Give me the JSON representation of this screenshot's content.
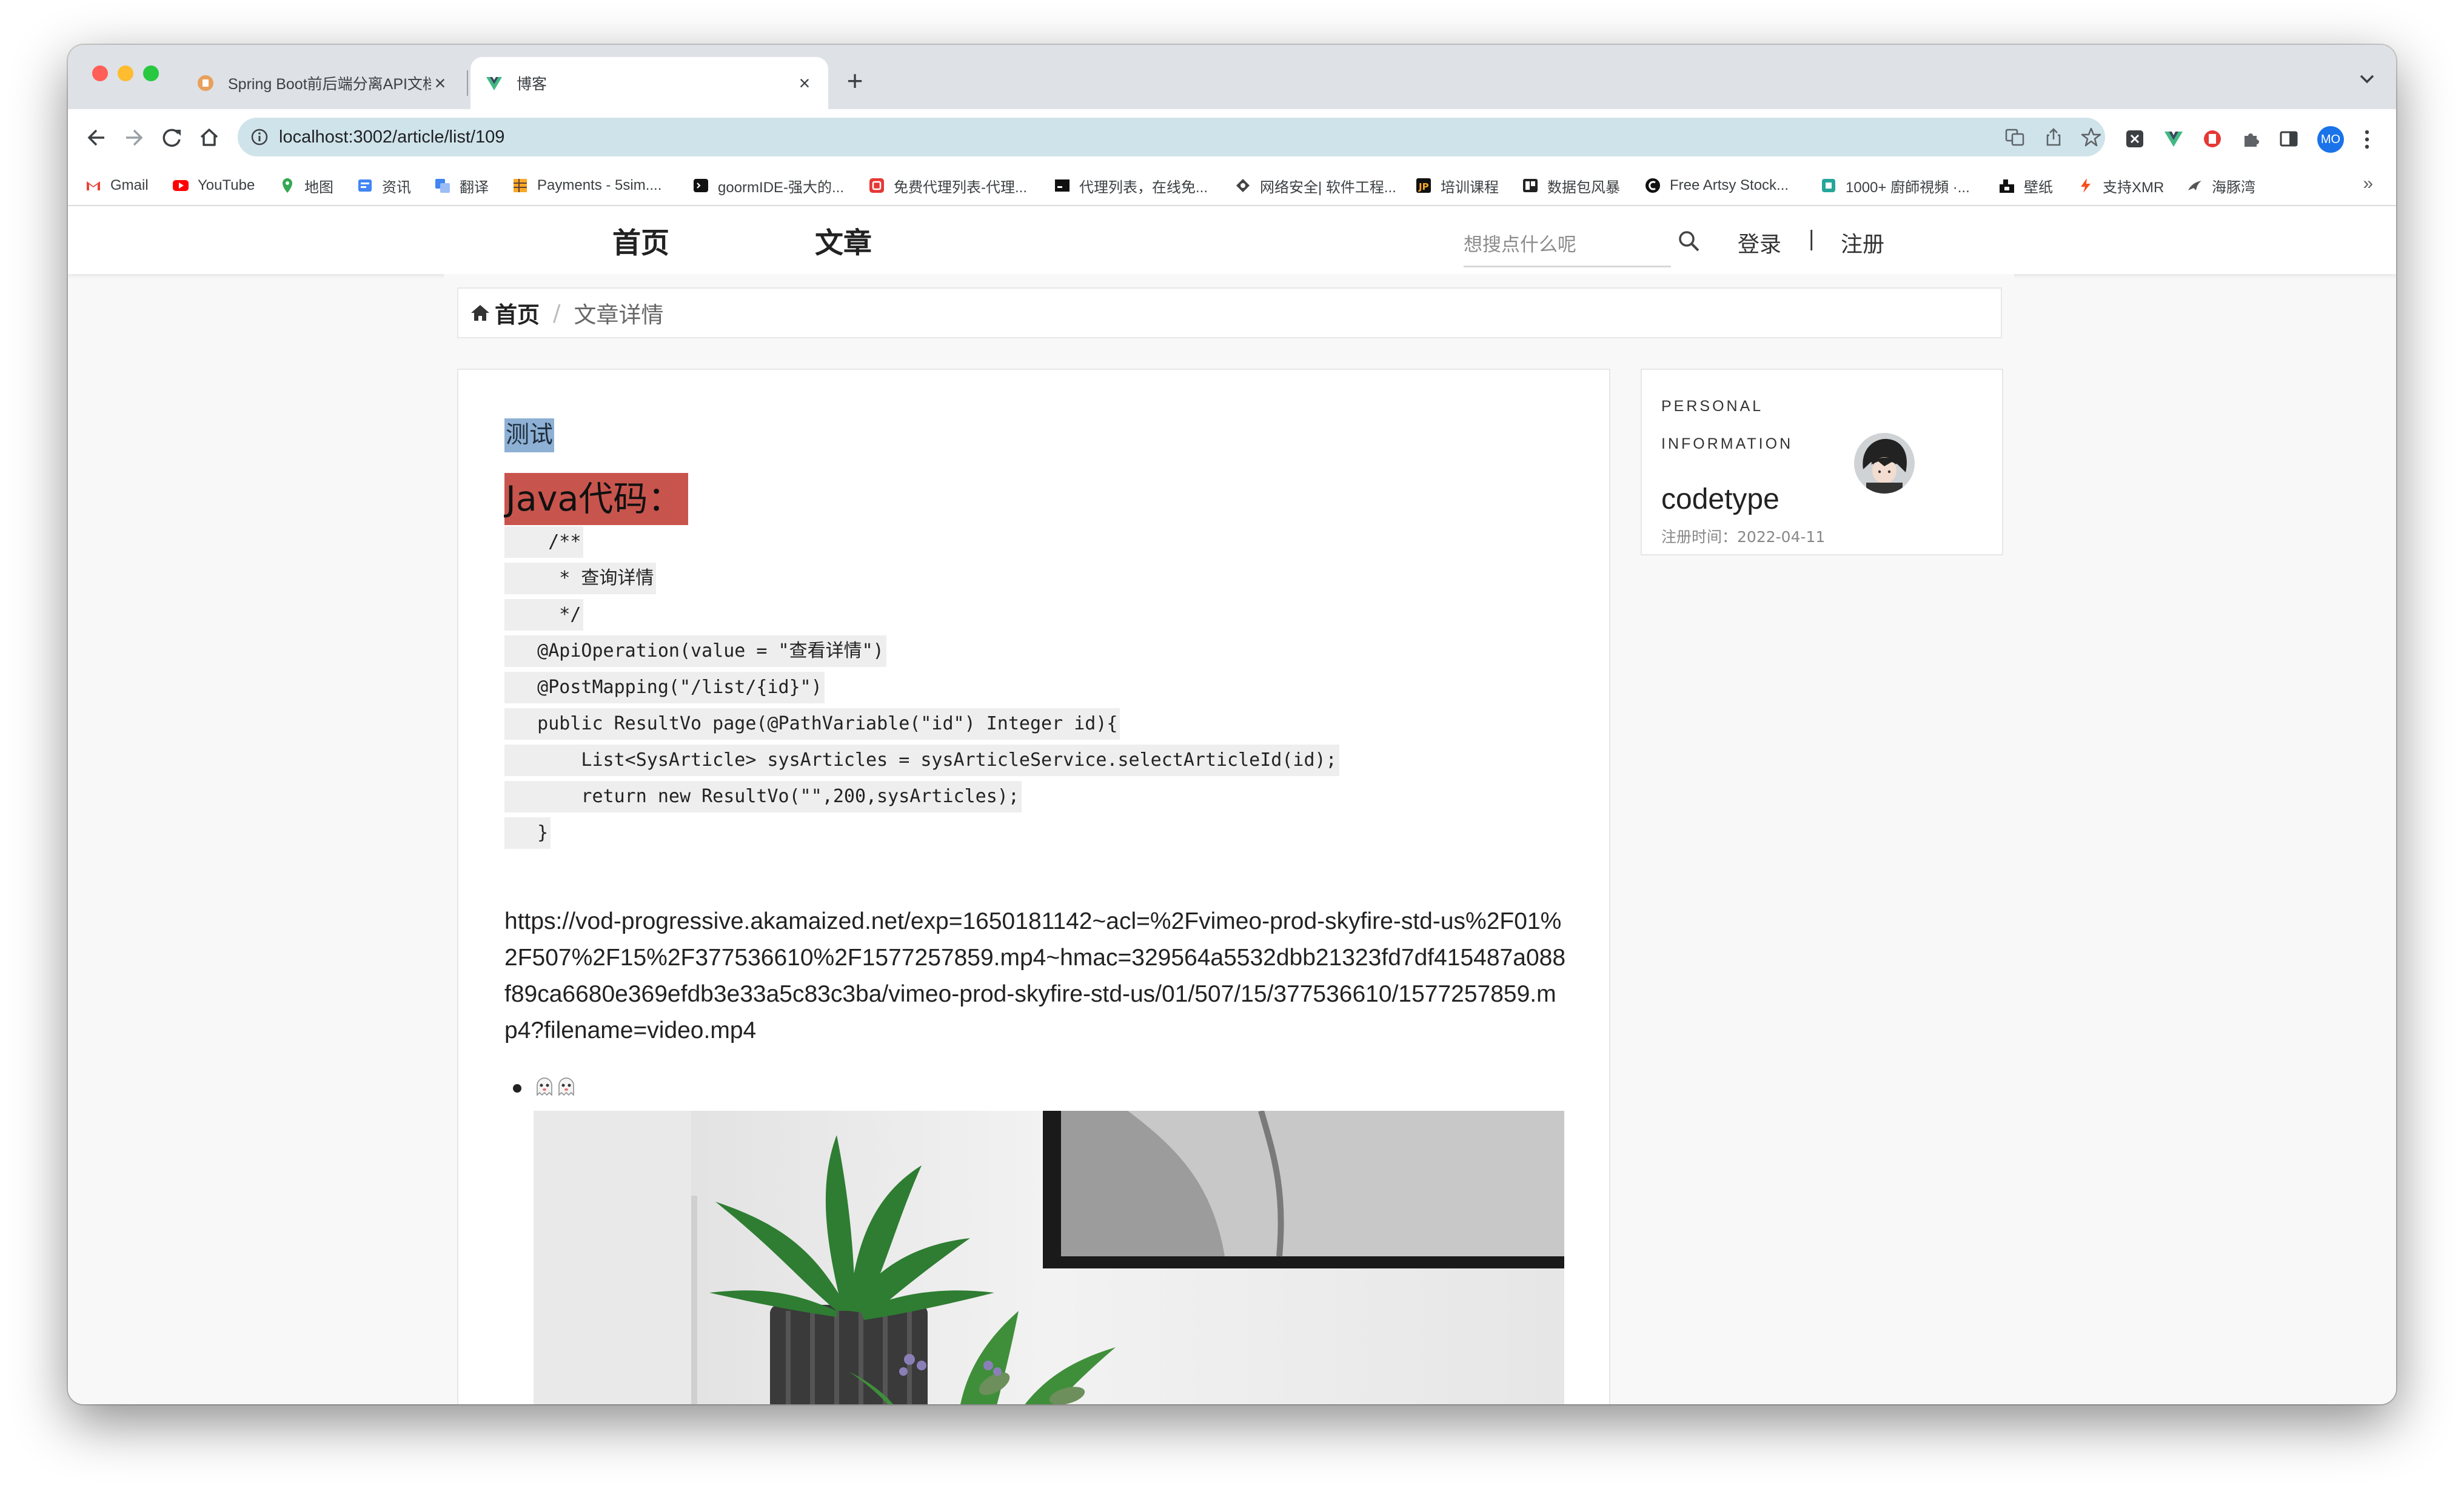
{
  "browser": {
    "tabs": [
      {
        "title": "Spring Boot前后端分离API文档",
        "active": false
      },
      {
        "title": "博客",
        "active": true
      }
    ],
    "address": "localhost:3002/article/list/109",
    "profile_initials": "MO",
    "bookmarks": [
      {
        "label": "Gmail",
        "icon": "gmail-icon"
      },
      {
        "label": "YouTube",
        "icon": "youtube-icon"
      },
      {
        "label": "地图",
        "icon": "maps-icon"
      },
      {
        "label": "资讯",
        "icon": "news-icon"
      },
      {
        "label": "翻译",
        "icon": "translate-icon"
      },
      {
        "label": "Payments - 5sim....",
        "icon": "payments-icon"
      },
      {
        "label": "goormIDE-强大的...",
        "icon": "terminal-icon"
      },
      {
        "label": "免费代理列表-代理...",
        "icon": "proxy-icon"
      },
      {
        "label": "代理列表，在线免...",
        "icon": "proxy-list-icon"
      },
      {
        "label": "网络安全| 软件工程...",
        "icon": "security-icon"
      },
      {
        "label": "培训课程",
        "icon": "course-icon"
      },
      {
        "label": "数据包风暴",
        "icon": "packet-icon"
      },
      {
        "label": "Free Artsy Stock...",
        "icon": "artsy-icon"
      },
      {
        "label": "1000+ 廚師視頻 ·...",
        "icon": "video-icon"
      },
      {
        "label": "壁纸",
        "icon": "wallpaper-icon"
      },
      {
        "label": "支持XMR",
        "icon": "xmr-icon"
      },
      {
        "label": "海豚湾",
        "icon": "dolphin-icon"
      }
    ],
    "more_bookmarks": "»"
  },
  "site": {
    "nav": {
      "home": "首页",
      "articles": "文章"
    },
    "search_placeholder": "想搜点什么呢",
    "login": "登录",
    "separator": "|",
    "register": "注册"
  },
  "breadcrumb": {
    "home": "首页",
    "separator": "/",
    "current": "文章详情"
  },
  "article": {
    "title": "测试",
    "heading": "Java代码：",
    "code_lines": [
      "    /**",
      "     * 查询详情",
      "     */",
      "   @ApiOperation(value = \"查看详情\")",
      "   @PostMapping(\"/list/{id}\")",
      "   public ResultVo page(@PathVariable(\"id\") Integer id){",
      "       List<SysArticle> sysArticles = sysArticleService.selectArticleId(id);",
      "       return new ResultVo(\"\",200,sysArticles);",
      "   }"
    ],
    "url_text": "https://vod-progressive.akamaized.net/exp=1650181142~acl=%2Fvimeo-prod-skyfire-std-us%2F01%2F507%2F15%2F377536610%2F1577257859.mp4~hmac=329564a5532dbb21323fd7df415487a088f89ca6680e369efdb3e33a5c83c3ba/vimeo-prod-skyfire-std-us/01/507/15/377536610/1577257859.mp4?filename=video.mp4",
    "list_item_icons": [
      "ghost-emoji-icon",
      "ghost-emoji-icon"
    ],
    "image": "photo-of-potted-plants-icon"
  },
  "profile_card": {
    "label_line1": "PERSONAL",
    "label_line2": "INFORMATION",
    "username": "codetype",
    "registered_label": "注册时间：",
    "registered_date": "2022-04-11"
  },
  "colors": {
    "title_highlight": "#8db0d4",
    "heading_highlight": "#c8554d",
    "code_background": "#eeeeee",
    "address_bar": "#cfe3ea"
  }
}
